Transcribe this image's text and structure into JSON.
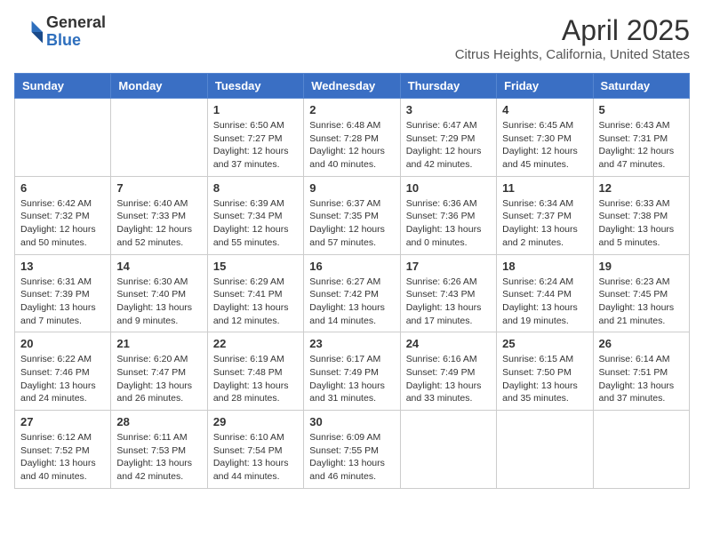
{
  "logo": {
    "general": "General",
    "blue": "Blue"
  },
  "title": "April 2025",
  "location": "Citrus Heights, California, United States",
  "days_of_week": [
    "Sunday",
    "Monday",
    "Tuesday",
    "Wednesday",
    "Thursday",
    "Friday",
    "Saturday"
  ],
  "weeks": [
    [
      {
        "day": "",
        "info": ""
      },
      {
        "day": "",
        "info": ""
      },
      {
        "day": "1",
        "info": "Sunrise: 6:50 AM\nSunset: 7:27 PM\nDaylight: 12 hours and 37 minutes."
      },
      {
        "day": "2",
        "info": "Sunrise: 6:48 AM\nSunset: 7:28 PM\nDaylight: 12 hours and 40 minutes."
      },
      {
        "day": "3",
        "info": "Sunrise: 6:47 AM\nSunset: 7:29 PM\nDaylight: 12 hours and 42 minutes."
      },
      {
        "day": "4",
        "info": "Sunrise: 6:45 AM\nSunset: 7:30 PM\nDaylight: 12 hours and 45 minutes."
      },
      {
        "day": "5",
        "info": "Sunrise: 6:43 AM\nSunset: 7:31 PM\nDaylight: 12 hours and 47 minutes."
      }
    ],
    [
      {
        "day": "6",
        "info": "Sunrise: 6:42 AM\nSunset: 7:32 PM\nDaylight: 12 hours and 50 minutes."
      },
      {
        "day": "7",
        "info": "Sunrise: 6:40 AM\nSunset: 7:33 PM\nDaylight: 12 hours and 52 minutes."
      },
      {
        "day": "8",
        "info": "Sunrise: 6:39 AM\nSunset: 7:34 PM\nDaylight: 12 hours and 55 minutes."
      },
      {
        "day": "9",
        "info": "Sunrise: 6:37 AM\nSunset: 7:35 PM\nDaylight: 12 hours and 57 minutes."
      },
      {
        "day": "10",
        "info": "Sunrise: 6:36 AM\nSunset: 7:36 PM\nDaylight: 13 hours and 0 minutes."
      },
      {
        "day": "11",
        "info": "Sunrise: 6:34 AM\nSunset: 7:37 PM\nDaylight: 13 hours and 2 minutes."
      },
      {
        "day": "12",
        "info": "Sunrise: 6:33 AM\nSunset: 7:38 PM\nDaylight: 13 hours and 5 minutes."
      }
    ],
    [
      {
        "day": "13",
        "info": "Sunrise: 6:31 AM\nSunset: 7:39 PM\nDaylight: 13 hours and 7 minutes."
      },
      {
        "day": "14",
        "info": "Sunrise: 6:30 AM\nSunset: 7:40 PM\nDaylight: 13 hours and 9 minutes."
      },
      {
        "day": "15",
        "info": "Sunrise: 6:29 AM\nSunset: 7:41 PM\nDaylight: 13 hours and 12 minutes."
      },
      {
        "day": "16",
        "info": "Sunrise: 6:27 AM\nSunset: 7:42 PM\nDaylight: 13 hours and 14 minutes."
      },
      {
        "day": "17",
        "info": "Sunrise: 6:26 AM\nSunset: 7:43 PM\nDaylight: 13 hours and 17 minutes."
      },
      {
        "day": "18",
        "info": "Sunrise: 6:24 AM\nSunset: 7:44 PM\nDaylight: 13 hours and 19 minutes."
      },
      {
        "day": "19",
        "info": "Sunrise: 6:23 AM\nSunset: 7:45 PM\nDaylight: 13 hours and 21 minutes."
      }
    ],
    [
      {
        "day": "20",
        "info": "Sunrise: 6:22 AM\nSunset: 7:46 PM\nDaylight: 13 hours and 24 minutes."
      },
      {
        "day": "21",
        "info": "Sunrise: 6:20 AM\nSunset: 7:47 PM\nDaylight: 13 hours and 26 minutes."
      },
      {
        "day": "22",
        "info": "Sunrise: 6:19 AM\nSunset: 7:48 PM\nDaylight: 13 hours and 28 minutes."
      },
      {
        "day": "23",
        "info": "Sunrise: 6:17 AM\nSunset: 7:49 PM\nDaylight: 13 hours and 31 minutes."
      },
      {
        "day": "24",
        "info": "Sunrise: 6:16 AM\nSunset: 7:49 PM\nDaylight: 13 hours and 33 minutes."
      },
      {
        "day": "25",
        "info": "Sunrise: 6:15 AM\nSunset: 7:50 PM\nDaylight: 13 hours and 35 minutes."
      },
      {
        "day": "26",
        "info": "Sunrise: 6:14 AM\nSunset: 7:51 PM\nDaylight: 13 hours and 37 minutes."
      }
    ],
    [
      {
        "day": "27",
        "info": "Sunrise: 6:12 AM\nSunset: 7:52 PM\nDaylight: 13 hours and 40 minutes."
      },
      {
        "day": "28",
        "info": "Sunrise: 6:11 AM\nSunset: 7:53 PM\nDaylight: 13 hours and 42 minutes."
      },
      {
        "day": "29",
        "info": "Sunrise: 6:10 AM\nSunset: 7:54 PM\nDaylight: 13 hours and 44 minutes."
      },
      {
        "day": "30",
        "info": "Sunrise: 6:09 AM\nSunset: 7:55 PM\nDaylight: 13 hours and 46 minutes."
      },
      {
        "day": "",
        "info": ""
      },
      {
        "day": "",
        "info": ""
      },
      {
        "day": "",
        "info": ""
      }
    ]
  ]
}
